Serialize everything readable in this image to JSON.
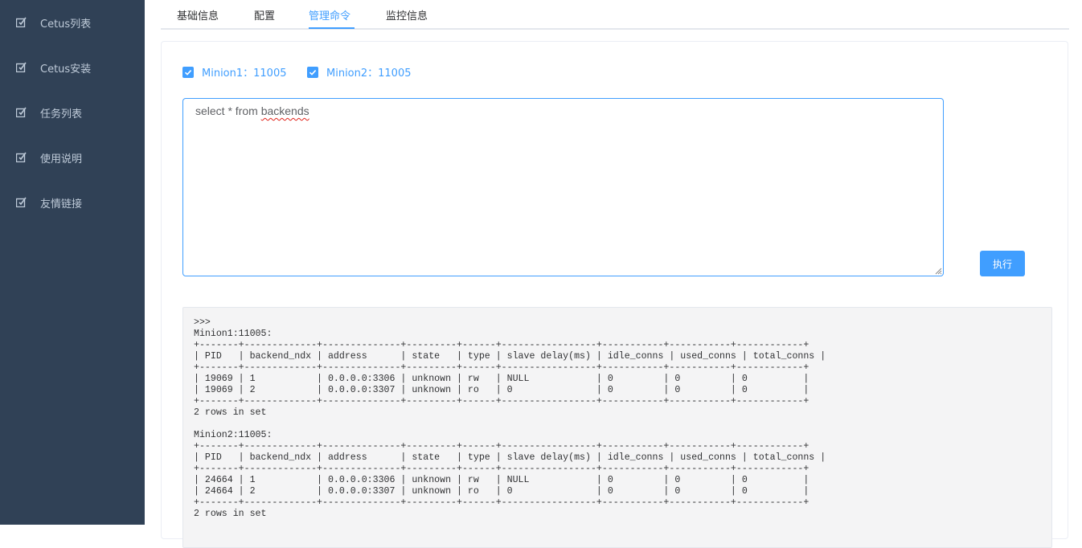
{
  "sidebar": {
    "items": [
      {
        "label": "Cetus列表",
        "icon": "edit-icon"
      },
      {
        "label": "Cetus安装",
        "icon": "edit-icon"
      },
      {
        "label": "任务列表",
        "icon": "edit-icon"
      },
      {
        "label": "使用说明",
        "icon": "edit-icon"
      },
      {
        "label": "友情链接",
        "icon": "edit-icon"
      }
    ]
  },
  "tabs": [
    {
      "label": "基础信息"
    },
    {
      "label": "配置"
    },
    {
      "label": "管理命令"
    },
    {
      "label": "监控信息"
    }
  ],
  "active_tab": "管理命令",
  "minions": [
    {
      "label": "Minion1：11005",
      "checked": true
    },
    {
      "label": "Minion2：11005",
      "checked": true
    }
  ],
  "query": {
    "prefix": "select * from ",
    "misspelled_word": "backends"
  },
  "execute_label": "执行",
  "output_text": ">>>\nMinion1:11005:\n+-------+-------------+--------------+---------+------+-----------------+-----------+-----------+------------+\n| PID   | backend_ndx | address      | state   | type | slave delay(ms) | idle_conns | used_conns | total_conns |\n+-------+-------------+--------------+---------+------+-----------------+-----------+-----------+------------+\n| 19069 | 1           | 0.0.0.0:3306 | unknown | rw   | NULL            | 0         | 0         | 0          |\n| 19069 | 2           | 0.0.0.0:3307 | unknown | ro   | 0               | 0         | 0         | 0          |\n+-------+-------------+--------------+---------+------+-----------------+-----------+-----------+------------+\n2 rows in set\n\nMinion2:11005:\n+-------+-------------+--------------+---------+------+-----------------+-----------+-----------+------------+\n| PID   | backend_ndx | address      | state   | type | slave delay(ms) | idle_conns | used_conns | total_conns |\n+-------+-------------+--------------+---------+------+-----------------+-----------+-----------+------------+\n| 24664 | 1           | 0.0.0.0:3306 | unknown | rw   | NULL            | 0         | 0         | 0          |\n| 24664 | 2           | 0.0.0.0:3307 | unknown | ro   | 0               | 0         | 0         | 0          |\n+-------+-------------+--------------+---------+------+-----------------+-----------+-----------+------------+\n2 rows in set",
  "colors": {
    "sidebar_bg": "#304156",
    "accent": "#409eff",
    "output_bg": "#f4f4f5"
  }
}
